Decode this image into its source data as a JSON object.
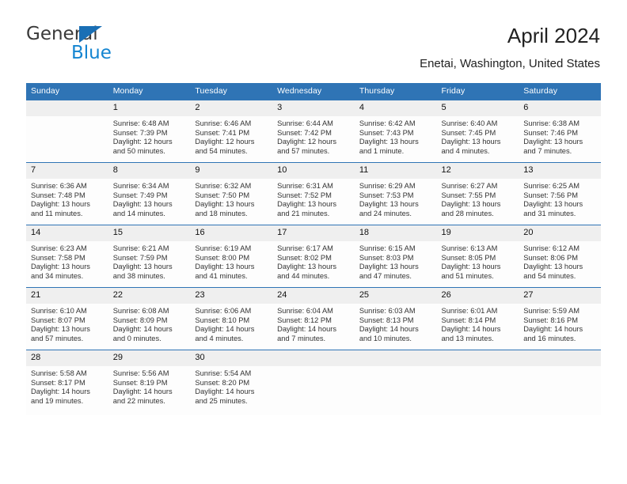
{
  "brand": {
    "name_part1": "General",
    "name_part2": "Blue",
    "triangle_icon": "triangle-icon",
    "color_dark": "#3a3a3a",
    "color_blue": "#1485d1",
    "accent": "#2f74b5"
  },
  "header": {
    "title": "April 2024",
    "subtitle": "Enetai, Washington, United States"
  },
  "calendar": {
    "weekday_headers": [
      "Sunday",
      "Monday",
      "Tuesday",
      "Wednesday",
      "Thursday",
      "Friday",
      "Saturday"
    ],
    "weeks": [
      [
        {
          "day": "",
          "sunrise": "",
          "sunset": "",
          "daylight1": "",
          "daylight2": ""
        },
        {
          "day": "1",
          "sunrise": "Sunrise: 6:48 AM",
          "sunset": "Sunset: 7:39 PM",
          "daylight1": "Daylight: 12 hours",
          "daylight2": "and 50 minutes."
        },
        {
          "day": "2",
          "sunrise": "Sunrise: 6:46 AM",
          "sunset": "Sunset: 7:41 PM",
          "daylight1": "Daylight: 12 hours",
          "daylight2": "and 54 minutes."
        },
        {
          "day": "3",
          "sunrise": "Sunrise: 6:44 AM",
          "sunset": "Sunset: 7:42 PM",
          "daylight1": "Daylight: 12 hours",
          "daylight2": "and 57 minutes."
        },
        {
          "day": "4",
          "sunrise": "Sunrise: 6:42 AM",
          "sunset": "Sunset: 7:43 PM",
          "daylight1": "Daylight: 13 hours",
          "daylight2": "and 1 minute."
        },
        {
          "day": "5",
          "sunrise": "Sunrise: 6:40 AM",
          "sunset": "Sunset: 7:45 PM",
          "daylight1": "Daylight: 13 hours",
          "daylight2": "and 4 minutes."
        },
        {
          "day": "6",
          "sunrise": "Sunrise: 6:38 AM",
          "sunset": "Sunset: 7:46 PM",
          "daylight1": "Daylight: 13 hours",
          "daylight2": "and 7 minutes."
        }
      ],
      [
        {
          "day": "7",
          "sunrise": "Sunrise: 6:36 AM",
          "sunset": "Sunset: 7:48 PM",
          "daylight1": "Daylight: 13 hours",
          "daylight2": "and 11 minutes."
        },
        {
          "day": "8",
          "sunrise": "Sunrise: 6:34 AM",
          "sunset": "Sunset: 7:49 PM",
          "daylight1": "Daylight: 13 hours",
          "daylight2": "and 14 minutes."
        },
        {
          "day": "9",
          "sunrise": "Sunrise: 6:32 AM",
          "sunset": "Sunset: 7:50 PM",
          "daylight1": "Daylight: 13 hours",
          "daylight2": "and 18 minutes."
        },
        {
          "day": "10",
          "sunrise": "Sunrise: 6:31 AM",
          "sunset": "Sunset: 7:52 PM",
          "daylight1": "Daylight: 13 hours",
          "daylight2": "and 21 minutes."
        },
        {
          "day": "11",
          "sunrise": "Sunrise: 6:29 AM",
          "sunset": "Sunset: 7:53 PM",
          "daylight1": "Daylight: 13 hours",
          "daylight2": "and 24 minutes."
        },
        {
          "day": "12",
          "sunrise": "Sunrise: 6:27 AM",
          "sunset": "Sunset: 7:55 PM",
          "daylight1": "Daylight: 13 hours",
          "daylight2": "and 28 minutes."
        },
        {
          "day": "13",
          "sunrise": "Sunrise: 6:25 AM",
          "sunset": "Sunset: 7:56 PM",
          "daylight1": "Daylight: 13 hours",
          "daylight2": "and 31 minutes."
        }
      ],
      [
        {
          "day": "14",
          "sunrise": "Sunrise: 6:23 AM",
          "sunset": "Sunset: 7:58 PM",
          "daylight1": "Daylight: 13 hours",
          "daylight2": "and 34 minutes."
        },
        {
          "day": "15",
          "sunrise": "Sunrise: 6:21 AM",
          "sunset": "Sunset: 7:59 PM",
          "daylight1": "Daylight: 13 hours",
          "daylight2": "and 38 minutes."
        },
        {
          "day": "16",
          "sunrise": "Sunrise: 6:19 AM",
          "sunset": "Sunset: 8:00 PM",
          "daylight1": "Daylight: 13 hours",
          "daylight2": "and 41 minutes."
        },
        {
          "day": "17",
          "sunrise": "Sunrise: 6:17 AM",
          "sunset": "Sunset: 8:02 PM",
          "daylight1": "Daylight: 13 hours",
          "daylight2": "and 44 minutes."
        },
        {
          "day": "18",
          "sunrise": "Sunrise: 6:15 AM",
          "sunset": "Sunset: 8:03 PM",
          "daylight1": "Daylight: 13 hours",
          "daylight2": "and 47 minutes."
        },
        {
          "day": "19",
          "sunrise": "Sunrise: 6:13 AM",
          "sunset": "Sunset: 8:05 PM",
          "daylight1": "Daylight: 13 hours",
          "daylight2": "and 51 minutes."
        },
        {
          "day": "20",
          "sunrise": "Sunrise: 6:12 AM",
          "sunset": "Sunset: 8:06 PM",
          "daylight1": "Daylight: 13 hours",
          "daylight2": "and 54 minutes."
        }
      ],
      [
        {
          "day": "21",
          "sunrise": "Sunrise: 6:10 AM",
          "sunset": "Sunset: 8:07 PM",
          "daylight1": "Daylight: 13 hours",
          "daylight2": "and 57 minutes."
        },
        {
          "day": "22",
          "sunrise": "Sunrise: 6:08 AM",
          "sunset": "Sunset: 8:09 PM",
          "daylight1": "Daylight: 14 hours",
          "daylight2": "and 0 minutes."
        },
        {
          "day": "23",
          "sunrise": "Sunrise: 6:06 AM",
          "sunset": "Sunset: 8:10 PM",
          "daylight1": "Daylight: 14 hours",
          "daylight2": "and 4 minutes."
        },
        {
          "day": "24",
          "sunrise": "Sunrise: 6:04 AM",
          "sunset": "Sunset: 8:12 PM",
          "daylight1": "Daylight: 14 hours",
          "daylight2": "and 7 minutes."
        },
        {
          "day": "25",
          "sunrise": "Sunrise: 6:03 AM",
          "sunset": "Sunset: 8:13 PM",
          "daylight1": "Daylight: 14 hours",
          "daylight2": "and 10 minutes."
        },
        {
          "day": "26",
          "sunrise": "Sunrise: 6:01 AM",
          "sunset": "Sunset: 8:14 PM",
          "daylight1": "Daylight: 14 hours",
          "daylight2": "and 13 minutes."
        },
        {
          "day": "27",
          "sunrise": "Sunrise: 5:59 AM",
          "sunset": "Sunset: 8:16 PM",
          "daylight1": "Daylight: 14 hours",
          "daylight2": "and 16 minutes."
        }
      ],
      [
        {
          "day": "28",
          "sunrise": "Sunrise: 5:58 AM",
          "sunset": "Sunset: 8:17 PM",
          "daylight1": "Daylight: 14 hours",
          "daylight2": "and 19 minutes."
        },
        {
          "day": "29",
          "sunrise": "Sunrise: 5:56 AM",
          "sunset": "Sunset: 8:19 PM",
          "daylight1": "Daylight: 14 hours",
          "daylight2": "and 22 minutes."
        },
        {
          "day": "30",
          "sunrise": "Sunrise: 5:54 AM",
          "sunset": "Sunset: 8:20 PM",
          "daylight1": "Daylight: 14 hours",
          "daylight2": "and 25 minutes."
        },
        {
          "day": "",
          "sunrise": "",
          "sunset": "",
          "daylight1": "",
          "daylight2": ""
        },
        {
          "day": "",
          "sunrise": "",
          "sunset": "",
          "daylight1": "",
          "daylight2": ""
        },
        {
          "day": "",
          "sunrise": "",
          "sunset": "",
          "daylight1": "",
          "daylight2": ""
        },
        {
          "day": "",
          "sunrise": "",
          "sunset": "",
          "daylight1": "",
          "daylight2": ""
        }
      ]
    ]
  }
}
